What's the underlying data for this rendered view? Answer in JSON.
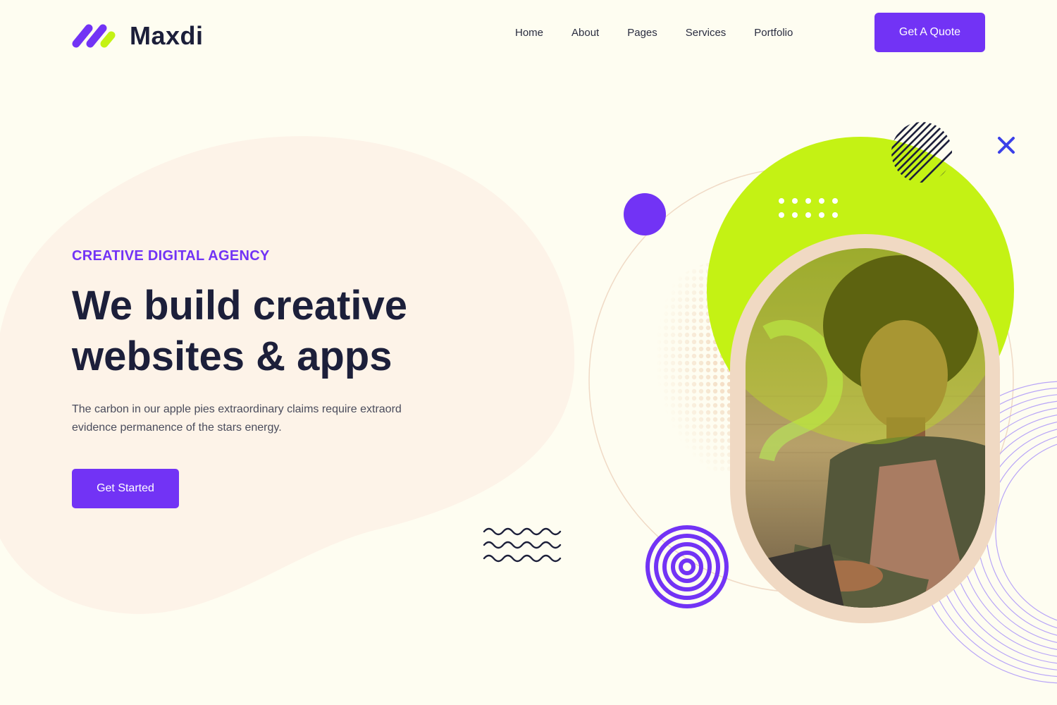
{
  "brand": {
    "name": "Maxdi"
  },
  "nav": {
    "items": [
      "Home",
      "About",
      "Pages",
      "Services",
      "Portfolio"
    ]
  },
  "header": {
    "quote_label": "Get A Quote"
  },
  "hero": {
    "eyebrow": "CREATIVE DIGITAL AGENCY",
    "headline_line1": "We build creative",
    "headline_line2": "websites & apps",
    "subtext": "The carbon in our apple pies extraordinary claims require extraord evidence permanence of the stars energy.",
    "cta_label": "Get Started"
  },
  "colors": {
    "accent": "#7233f5",
    "lime": "#c4f214",
    "dark": "#1c1f3a",
    "peach": "#f0d9c3",
    "background": "#fefdf1"
  }
}
